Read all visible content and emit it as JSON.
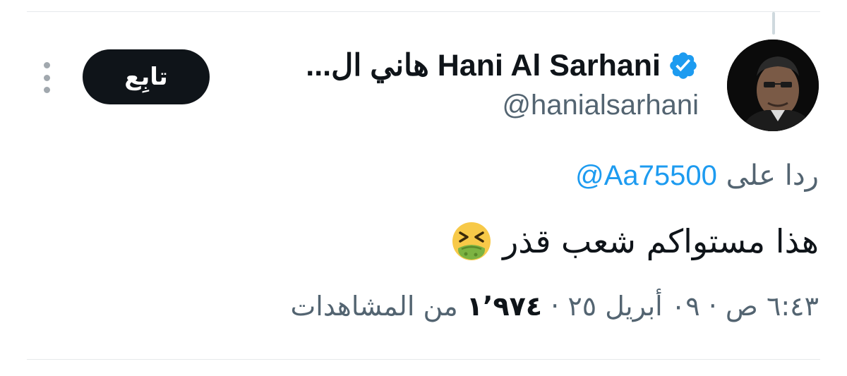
{
  "author": {
    "display_name": "...هاني ال Hani Al Sarhani",
    "handle": "@hanialsarhani",
    "verified": true
  },
  "actions": {
    "follow_label": "تابِع",
    "more_icon": "more-vertical-icon"
  },
  "reply": {
    "prefix": "ردا على",
    "mention": "@Aa75500"
  },
  "tweet": {
    "text": "هذا مستواكم شعب قذر",
    "emoji": "nauseated-face-emoji"
  },
  "meta": {
    "time": "٦:٤٣ ص",
    "separator": "·",
    "date": "٠٩ أبريل ٢٥",
    "views_count": "١٬٩٧٤",
    "views_label": "من المشاهدات"
  },
  "colors": {
    "accent": "#1d9bf0",
    "text": "#0f1419",
    "secondary": "#536471",
    "follow_bg": "#0f1419"
  }
}
